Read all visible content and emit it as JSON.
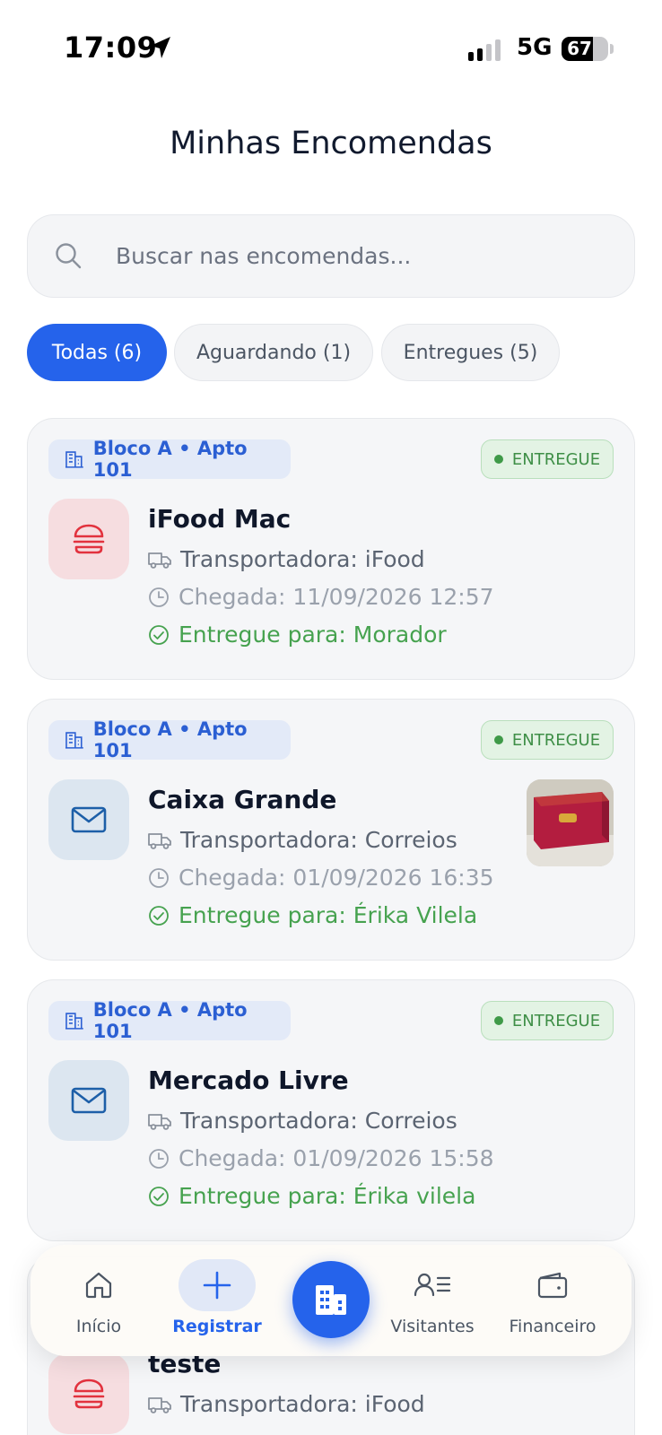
{
  "status_bar": {
    "time": "17:09",
    "network": "5G",
    "battery_level": "67",
    "battery_fraction": 0.67,
    "signal_bars_active": 2,
    "signal_bars_total": 4
  },
  "header": {
    "title": "Minhas Encomendas"
  },
  "search": {
    "placeholder": "Buscar nas encomendas...",
    "value": ""
  },
  "filters": [
    {
      "label": "Todas (6)",
      "active": true
    },
    {
      "label": "Aguardando (1)",
      "active": false
    },
    {
      "label": "Entregues (5)",
      "active": false
    }
  ],
  "packages": [
    {
      "location": "Bloco A • Apto 101",
      "status": "ENTREGUE",
      "icon": "burger-icon",
      "title": "iFood Mac",
      "carrier": "Transportadora: iFood",
      "arrival": "Chegada: 11/09/2026 12:57",
      "delivered_to": "Entregue para: Morador"
    },
    {
      "location": "Bloco A • Apto 101",
      "status": "ENTREGUE",
      "icon": "mail-icon",
      "title": "Caixa Grande",
      "carrier": "Transportadora: Correios",
      "arrival": "Chegada: 01/09/2026 16:35",
      "delivered_to": "Entregue para: Érika Vilela"
    },
    {
      "location": "Bloco A • Apto 101",
      "status": "ENTREGUE",
      "icon": "mail-icon",
      "title": "Mercado Livre",
      "carrier": "Transportadora: Correios",
      "arrival": "Chegada: 01/09/2026 15:58",
      "delivered_to": "Entregue para: Érika vilela"
    },
    {
      "icon": "burger-icon",
      "title": "teste",
      "carrier": "Transportadora: iFood"
    }
  ],
  "bottom_nav": {
    "items": [
      {
        "label": "Início",
        "icon": "home-icon",
        "active": false
      },
      {
        "label": "Registrar",
        "icon": "plus-icon",
        "active": true
      },
      {
        "label": "",
        "icon": "building-icon",
        "active": false
      },
      {
        "label": "Visitantes",
        "icon": "visitors-icon",
        "active": false
      },
      {
        "label": "Financeiro",
        "icon": "wallet-icon",
        "active": false
      }
    ]
  },
  "colors": {
    "primary": "#2563eb",
    "success": "#46a24f",
    "food_icon": "#e2323e",
    "mail_icon": "#1d5fa8"
  }
}
